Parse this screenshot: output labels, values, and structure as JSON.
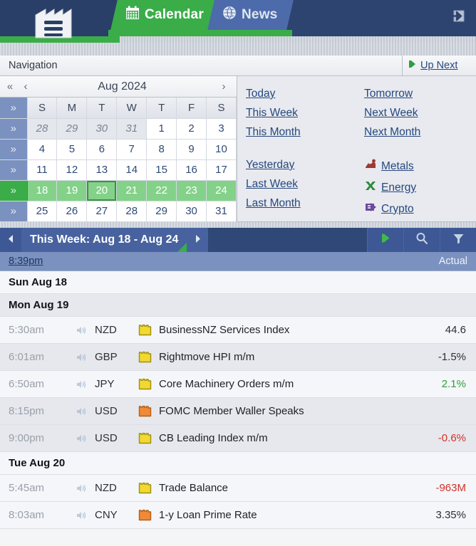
{
  "topbar": {
    "logo_icon": "factory-logo-icon",
    "tabs": [
      {
        "label": "Calendar",
        "icon": "calendar-grid-icon",
        "active": true
      },
      {
        "label": "News",
        "icon": "globe-icon",
        "active": false
      }
    ],
    "login_icon": "login-arrow-icon",
    "accent_green": "#3aad49",
    "accent_blue": "#2e4470"
  },
  "navigation": {
    "title": "Navigation",
    "up_next": {
      "label": "Up Next",
      "icon": "play-triangle-icon"
    }
  },
  "calendar": {
    "month_label": "Aug 2024",
    "prev_year_icon": "double-chevron-left-icon",
    "prev_month_icon": "chevron-left-icon",
    "next_month_icon": "chevron-right-icon",
    "week_expand_icon": "double-chevron-right-icon",
    "week_expand_down_icon": "double-chevron-down-icon",
    "dow": [
      "S",
      "M",
      "T",
      "W",
      "T",
      "F",
      "S"
    ],
    "weeks": [
      {
        "selected": false,
        "days": [
          {
            "n": "28",
            "other": true
          },
          {
            "n": "29",
            "other": true
          },
          {
            "n": "30",
            "other": true
          },
          {
            "n": "31",
            "other": true
          },
          {
            "n": "1"
          },
          {
            "n": "2"
          },
          {
            "n": "3"
          }
        ]
      },
      {
        "selected": false,
        "days": [
          {
            "n": "4"
          },
          {
            "n": "5"
          },
          {
            "n": "6"
          },
          {
            "n": "7"
          },
          {
            "n": "8"
          },
          {
            "n": "9"
          },
          {
            "n": "10"
          }
        ]
      },
      {
        "selected": false,
        "days": [
          {
            "n": "11"
          },
          {
            "n": "12"
          },
          {
            "n": "13"
          },
          {
            "n": "14"
          },
          {
            "n": "15"
          },
          {
            "n": "16"
          },
          {
            "n": "17"
          }
        ]
      },
      {
        "selected": true,
        "days": [
          {
            "n": "18"
          },
          {
            "n": "19"
          },
          {
            "n": "20",
            "today": true
          },
          {
            "n": "21"
          },
          {
            "n": "22"
          },
          {
            "n": "23"
          },
          {
            "n": "24"
          }
        ]
      },
      {
        "selected": false,
        "days": [
          {
            "n": "25"
          },
          {
            "n": "26"
          },
          {
            "n": "27"
          },
          {
            "n": "28"
          },
          {
            "n": "29"
          },
          {
            "n": "30"
          },
          {
            "n": "31"
          }
        ]
      }
    ]
  },
  "quick_links": {
    "column_left": [
      "Today",
      "This Week",
      "This Month",
      "Yesterday",
      "Last Week",
      "Last Month"
    ],
    "column_right": [
      "Tomorrow",
      "Next Week",
      "Next Month"
    ],
    "markets": [
      {
        "label": "Metals",
        "icon": "metals-icon",
        "color": "#9b3a33"
      },
      {
        "label": "Energy",
        "icon": "energy-icon",
        "color": "#2d8a3e"
      },
      {
        "label": "Crypto",
        "icon": "crypto-icon",
        "color": "#6b4a9e"
      }
    ]
  },
  "week_toolbar": {
    "prev_icon": "triangle-left-icon",
    "next_icon": "triangle-right-icon",
    "title": "This Week: Aug 18 - Aug 24",
    "buttons": [
      {
        "name": "upnext-button",
        "icon": "play-triangle-icon"
      },
      {
        "name": "search-button",
        "icon": "search-icon"
      },
      {
        "name": "filter-button",
        "icon": "filter-funnel-icon"
      }
    ]
  },
  "column_header": {
    "time": "8:39pm",
    "actual": "Actual"
  },
  "events": [
    {
      "type": "day",
      "label": "Sun Aug 18",
      "shade": "plain"
    },
    {
      "type": "day",
      "label": "Mon Aug 19",
      "shade": "alt"
    },
    {
      "type": "event",
      "time": "5:30am",
      "speaker_icon": "sound-icon",
      "currency": "NZD",
      "impact": "low",
      "impact_icon": "impact-folder-icon",
      "title": "BusinessNZ Services Index",
      "value": "44.6",
      "trend": "neutral",
      "shade": "odd"
    },
    {
      "type": "event",
      "time": "6:01am",
      "speaker_icon": "sound-icon",
      "currency": "GBP",
      "impact": "low",
      "impact_icon": "impact-folder-icon",
      "title": "Rightmove HPI m/m",
      "value": "-1.5%",
      "trend": "neutral",
      "shade": "even"
    },
    {
      "type": "event",
      "time": "6:50am",
      "speaker_icon": "sound-icon",
      "currency": "JPY",
      "impact": "low",
      "impact_icon": "impact-folder-icon",
      "title": "Core Machinery Orders m/m",
      "value": "2.1%",
      "trend": "up",
      "shade": "odd"
    },
    {
      "type": "event",
      "time": "8:15pm",
      "speaker_icon": "sound-icon",
      "currency": "USD",
      "impact": "medium",
      "impact_icon": "impact-folder-icon",
      "title": "FOMC Member Waller Speaks",
      "value": "",
      "trend": "neutral",
      "shade": "even"
    },
    {
      "type": "event",
      "time": "9:00pm",
      "speaker_icon": "sound-icon",
      "currency": "USD",
      "impact": "low",
      "impact_icon": "impact-folder-icon",
      "title": "CB Leading Index m/m",
      "value": "-0.6%",
      "trend": "down",
      "shade": "even"
    },
    {
      "type": "day",
      "label": "Tue Aug 20",
      "shade": "plain"
    },
    {
      "type": "event",
      "time": "5:45am",
      "speaker_icon": "sound-icon",
      "currency": "NZD",
      "impact": "low",
      "impact_icon": "impact-folder-icon",
      "title": "Trade Balance",
      "value": "-963M",
      "trend": "down",
      "shade": "odd"
    },
    {
      "type": "event",
      "time": "8:03am",
      "speaker_icon": "sound-icon",
      "currency": "CNY",
      "impact": "medium",
      "impact_icon": "impact-folder-icon",
      "title": "1-y Loan Prime Rate",
      "value": "3.35%",
      "trend": "neutral",
      "shade": "odd"
    }
  ],
  "colors": {
    "impact_low": "#f2d830",
    "impact_low_border": "#9c8f14",
    "impact_medium": "#f08a38",
    "impact_medium_border": "#b55f19",
    "value_up": "#2f9e3f",
    "value_down": "#d1322a",
    "link": "#26487e"
  }
}
